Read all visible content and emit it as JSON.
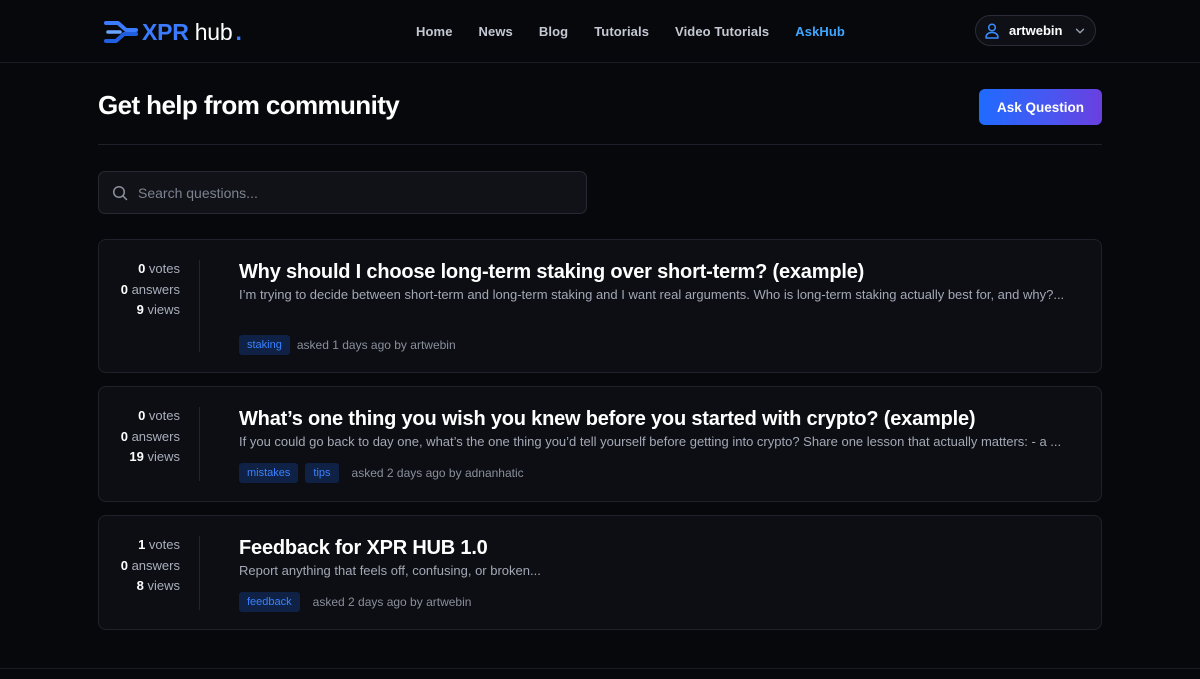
{
  "brand": {
    "xpr": "XPR",
    "hub": "hub",
    "dot": "."
  },
  "nav": [
    {
      "label": "Home",
      "active": false
    },
    {
      "label": "News",
      "active": false
    },
    {
      "label": "Blog",
      "active": false
    },
    {
      "label": "Tutorials",
      "active": false
    },
    {
      "label": "Video Tutorials",
      "active": false
    },
    {
      "label": "AskHub",
      "active": true
    }
  ],
  "user": {
    "name": "artwebin",
    "icon": "user-icon"
  },
  "page": {
    "title": "Get help from community",
    "ask_button": "Ask Question"
  },
  "search": {
    "placeholder": "Search questions...",
    "value": ""
  },
  "labels": {
    "votes": "votes",
    "answers": "answers",
    "views": "views",
    "asked": "asked"
  },
  "questions": [
    {
      "votes": "0",
      "answers": "0",
      "views": "9",
      "title": "Why should I choose long-term staking over short-term? (example)",
      "excerpt": "I’m trying to decide between short-term and long-term staking and I want real arguments. Who is long-term staking actually best for, and why?...",
      "tags": [
        "staking"
      ],
      "asked": "asked 1 days ago by artwebin"
    },
    {
      "votes": "0",
      "answers": "0",
      "views": "19",
      "title": "What’s one thing you wish you knew before you started with crypto? (example)",
      "excerpt": "If you could go back to day one, what’s the one thing you’d tell yourself before getting into crypto? Share one lesson that actually matters: - a ...",
      "tags": [
        "mistakes",
        "tips"
      ],
      "asked": "asked 2 days ago by adnanhatic"
    },
    {
      "votes": "1",
      "answers": "0",
      "views": "8",
      "title": "Feedback for XPR HUB 1.0",
      "excerpt": "Report anything that feels off, confusing, or broken...",
      "tags": [
        "feedback"
      ],
      "asked": "asked 2 days ago by artwebin"
    }
  ],
  "colors": {
    "accent": "#3a7bff",
    "active_nav": "#3fa7ff",
    "tag_bg": "#0f2144",
    "tag_text": "#3a82ff"
  }
}
